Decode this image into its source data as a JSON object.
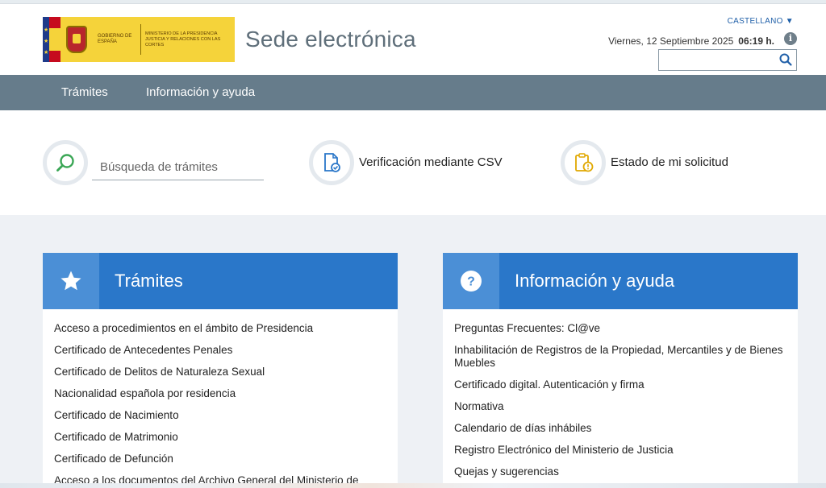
{
  "header": {
    "logo_text_1": "Gobierno de España",
    "logo_text_2": "Ministerio de la Presidencia Justicia y Relaciones con las Cortes",
    "title": "Sede electrónica",
    "language": "CASTELLANO ▼",
    "date": "Viernes, 12 Septiembre 2025",
    "time": "06:19 h.",
    "search_value": ""
  },
  "nav": {
    "items": [
      "Trámites",
      "Información y ayuda"
    ]
  },
  "quick": {
    "search_placeholder": "Búsqueda de trámites",
    "csv_label": "Verificación mediante CSV",
    "status_label": "Estado de mi solicitud"
  },
  "tramites": {
    "title": "Trámites",
    "items": [
      "Acceso a procedimientos en el ámbito de Presidencia",
      "Certificado de Antecedentes Penales",
      "Certificado de Delitos de Naturaleza Sexual",
      "Nacionalidad española por residencia",
      "Certificado de Nacimiento",
      "Certificado de Matrimonio",
      "Certificado de Defunción",
      "Acceso a los documentos del Archivo General del Ministerio de"
    ]
  },
  "info": {
    "title": "Información y ayuda",
    "items": [
      "Preguntas Frecuentes: Cl@ve",
      "Inhabilitación de Registros de la Propiedad, Mercantiles y de Bienes Muebles",
      "Certificado digital. Autenticación y firma",
      "Normativa",
      "Calendario de días inhábiles",
      "Registro Electrónico del Ministerio de Justicia",
      "Quejas y sugerencias"
    ]
  },
  "colors": {
    "nav_bg": "#667c8b",
    "panel_header": "#2a77c9",
    "panel_icon_bg": "#4b8fd6",
    "link_blue": "#1f5fa8",
    "search_icon_green": "#3aa655"
  },
  "icons": {
    "search": "search-icon",
    "csv": "document-check-icon",
    "status": "clipboard-clock-icon",
    "star": "star-icon",
    "help": "question-icon",
    "info": "info-icon"
  }
}
